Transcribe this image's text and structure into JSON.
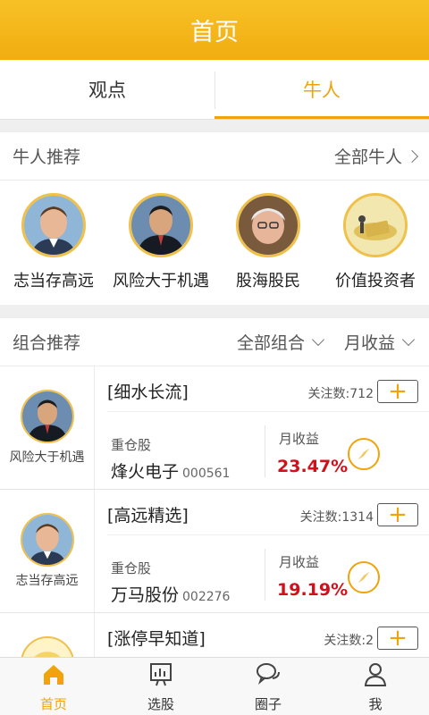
{
  "header": {
    "title": "首页"
  },
  "tabs": [
    {
      "label": "观点"
    },
    {
      "label": "牛人"
    }
  ],
  "experts_section": {
    "title": "牛人推荐",
    "all_link": "全部牛人",
    "items": [
      {
        "name": "志当存高远"
      },
      {
        "name": "风险大于机遇"
      },
      {
        "name": "股海股民"
      },
      {
        "name": "价值投资者"
      }
    ]
  },
  "portfolio_section": {
    "title": "组合推荐",
    "filter_all": "全部组合",
    "filter_sort": "月收益"
  },
  "portfolios": [
    {
      "manager": "风险大于机遇",
      "name": "[细水长流]",
      "follow": "关注数:712",
      "holding_label": "重仓股",
      "stock_name": "烽火电子",
      "stock_code": "000561",
      "return_label": "月收益",
      "return_value": "23.47%"
    },
    {
      "manager": "志当存高远",
      "name": "[高远精选]",
      "follow": "关注数:1314",
      "holding_label": "重仓股",
      "stock_name": "万马股份",
      "stock_code": "002276",
      "return_label": "月收益",
      "return_value": "19.19%"
    },
    {
      "manager": "",
      "name": "[涨停早知道]",
      "follow": "关注数:2",
      "holding_label": "",
      "stock_name": "",
      "stock_code": "",
      "return_label": "",
      "return_value": ""
    }
  ],
  "nav": [
    {
      "label": "首页",
      "icon": "home-icon"
    },
    {
      "label": "选股",
      "icon": "chart-icon"
    },
    {
      "label": "圈子",
      "icon": "chat-icon"
    },
    {
      "label": "我",
      "icon": "user-icon"
    }
  ],
  "colors": {
    "accent": "#f0a30a",
    "title_bar": "#f4b31b",
    "return_red": "#d0111b"
  }
}
